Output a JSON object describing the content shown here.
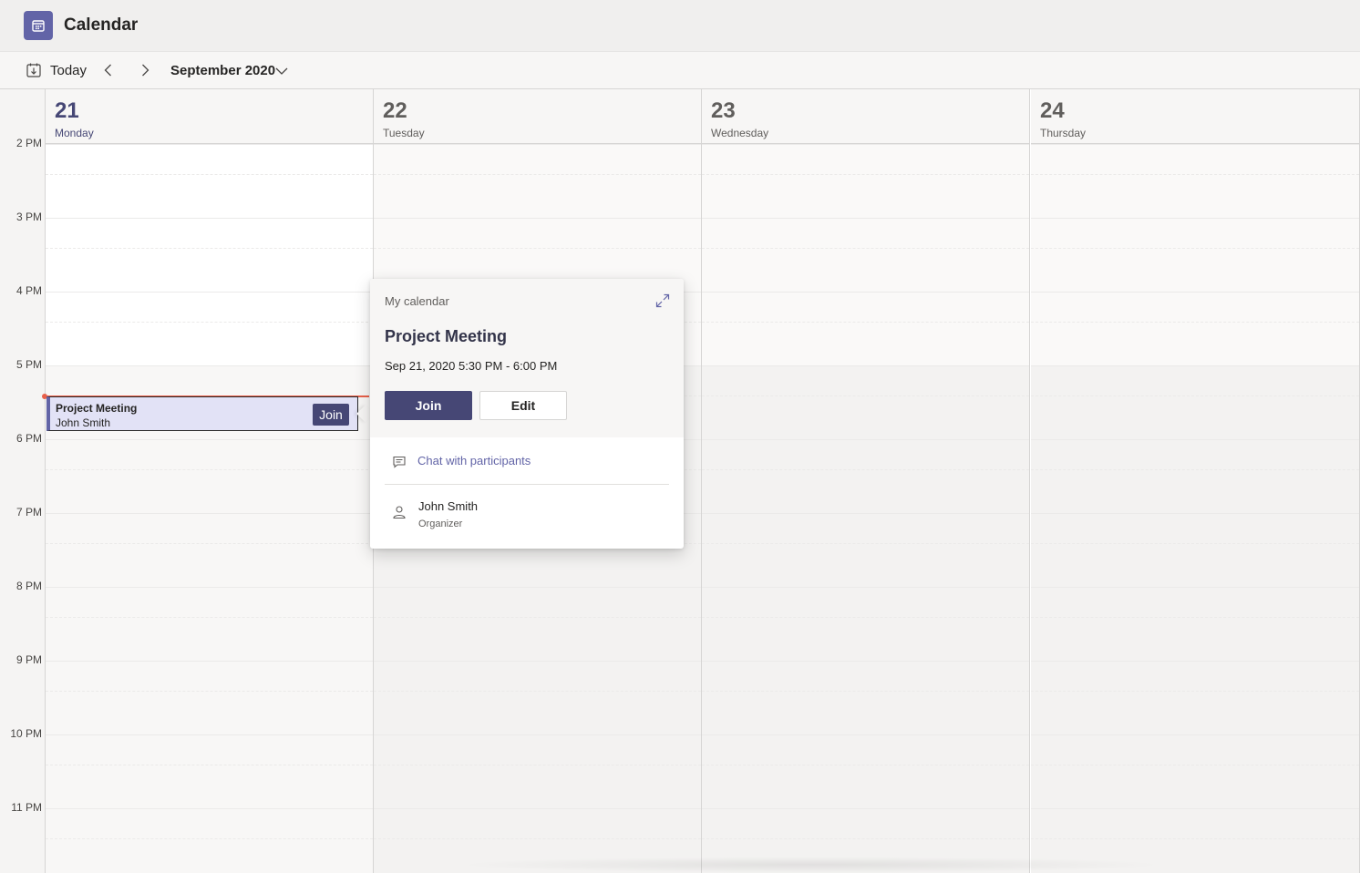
{
  "app": {
    "title": "Calendar",
    "icon": "calendar-icon",
    "accent": "#6264a7"
  },
  "toolbar": {
    "today_label": "Today",
    "month_label": "September 2020"
  },
  "time_labels": [
    "2 PM",
    "3 PM",
    "4 PM",
    "5 PM",
    "6 PM",
    "7 PM",
    "8 PM",
    "9 PM",
    "10 PM",
    "11 PM"
  ],
  "days": [
    {
      "num": "21",
      "name": "Monday",
      "today": true
    },
    {
      "num": "22",
      "name": "Tuesday",
      "today": false
    },
    {
      "num": "23",
      "name": "Wednesday",
      "today": false
    },
    {
      "num": "24",
      "name": "Thursday",
      "today": false
    }
  ],
  "event": {
    "title": "Project Meeting",
    "organizer": "John Smith",
    "join_label": "Join"
  },
  "popup": {
    "calendar_name": "My calendar",
    "title": "Project Meeting",
    "time": "Sep 21, 2020 5:30 PM - 6:00 PM",
    "join_label": "Join",
    "edit_label": "Edit",
    "chat_label": "Chat with participants",
    "organizer_name": "John Smith",
    "organizer_role": "Organizer"
  },
  "colors": {
    "now_indicator": "#e8604a",
    "event_fill": "#e2e2f6",
    "button_primary": "#464775"
  }
}
